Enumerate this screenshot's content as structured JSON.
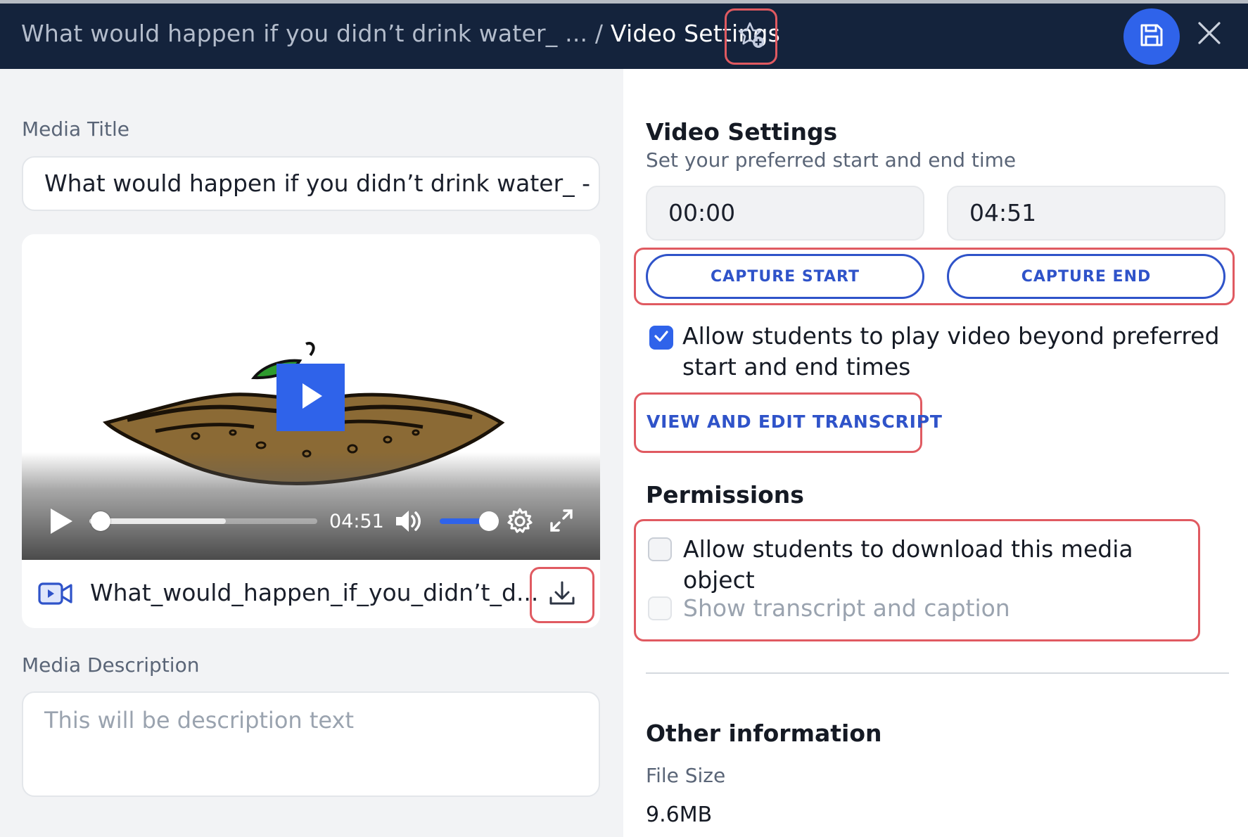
{
  "header": {
    "breadcrumb_parent": "What would happen if you didn’t drink water_ ...",
    "breadcrumb_sep": " / ",
    "breadcrumb_current": "Video Settings"
  },
  "left": {
    "media_title_label": "Media Title",
    "media_title_value": "What would happen if you didn’t drink water_ - M",
    "player": {
      "time": "04:51",
      "progress_played": 0.0,
      "progress_buffered": 0.6,
      "volume": 0.85
    },
    "file_name": "What_would_happen_if_you_didn’t_d...",
    "media_description_label": "Media Description",
    "media_description_placeholder": "This will be description text"
  },
  "right": {
    "video_settings_heading": "Video Settings",
    "video_settings_sub": "Set your preferred start and end time",
    "start_time": "00:00",
    "end_time": "04:51",
    "capture_start_label": "CAPTURE START",
    "capture_end_label": "CAPTURE END",
    "allow_beyond_line1": "Allow students to play video beyond preferred",
    "allow_beyond_line2": "start and end times",
    "allow_beyond_checked": true,
    "view_transcript_label": "VIEW AND EDIT TRANSCRIPT",
    "permissions_heading": "Permissions",
    "allow_download_label": "Allow students to download this media object",
    "allow_download_checked": false,
    "show_transcript_label": "Show transcript and caption",
    "show_transcript_checked": false,
    "other_info_heading": "Other information",
    "file_size_label": "File Size",
    "file_size_value": "9.6MB"
  },
  "colors": {
    "header_bg": "#14233c",
    "accent": "#2f63ea",
    "link": "#2f53c9",
    "highlight_border": "#e05a61"
  },
  "icons": [
    "star-add-icon",
    "save-icon",
    "close-icon",
    "play-icon",
    "volume-icon",
    "gear-icon",
    "fullscreen-icon",
    "video-file-icon",
    "download-icon",
    "check-icon"
  ]
}
